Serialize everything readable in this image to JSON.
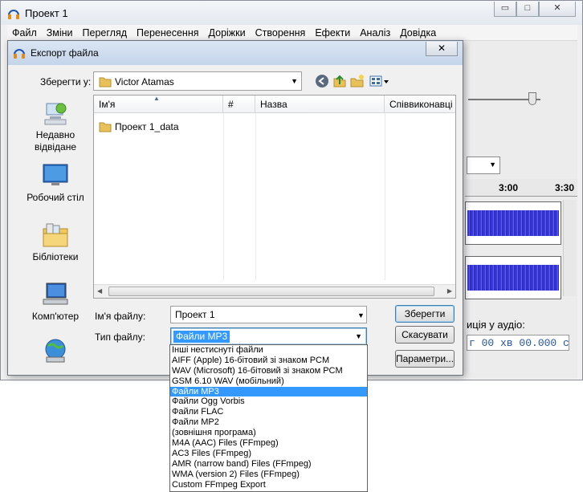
{
  "main_window": {
    "title": "Проект 1",
    "controls": {
      "minimize": "▭",
      "maximize": "□",
      "close": "✕"
    },
    "menu": [
      "Файл",
      "Зміни",
      "Перегляд",
      "Перенесення",
      "Доріжки",
      "Створення",
      "Ефекти",
      "Аналіз",
      "Довідка"
    ],
    "timeline": {
      "tick_1": "3:00",
      "tick_2": "3:30"
    },
    "selection": {
      "label": "иція у аудіо:",
      "value": "г 00 хв 00.000 с"
    }
  },
  "dialog": {
    "title": "Експорт файла",
    "close_label": "✕",
    "save_in": {
      "label": "Зберегти у:",
      "value": "Victor Atamas"
    },
    "places": [
      "Недавно відвідане",
      "Робочий стіл",
      "Бібліотеки",
      "Комп'ютер",
      ""
    ],
    "columns": [
      "Ім'я",
      "#",
      "Назва",
      "Співвиконавці"
    ],
    "files": [
      {
        "name": "Проект 1_data"
      }
    ],
    "file_name": {
      "label": "Ім'я файлу:",
      "value": "Проект 1"
    },
    "file_type": {
      "label": "Тип файлу:",
      "value": "Файли MP3"
    },
    "buttons": {
      "save": "Зберегти",
      "cancel": "Скасувати",
      "options": "Параметри..."
    },
    "type_options": [
      "Інші нестиснуті файли",
      "AIFF (Apple) 16-бітовий зі знаком PCM",
      "WAV (Microsoft) 16-бітовий зі знаком PCM",
      "GSM 6.10 WAV (мобільний)",
      "Файли MP3",
      "Файли Ogg Vorbis",
      "Файли FLAC",
      "Файли MP2",
      "(зовнішня програма)",
      "M4A (AAC) Files (FFmpeg)",
      "AC3 Files (FFmpeg)",
      "AMR (narrow band) Files (FFmpeg)",
      "WMA (version 2) Files (FFmpeg)",
      "Custom FFmpeg Export"
    ],
    "selected_type_index": 4
  }
}
